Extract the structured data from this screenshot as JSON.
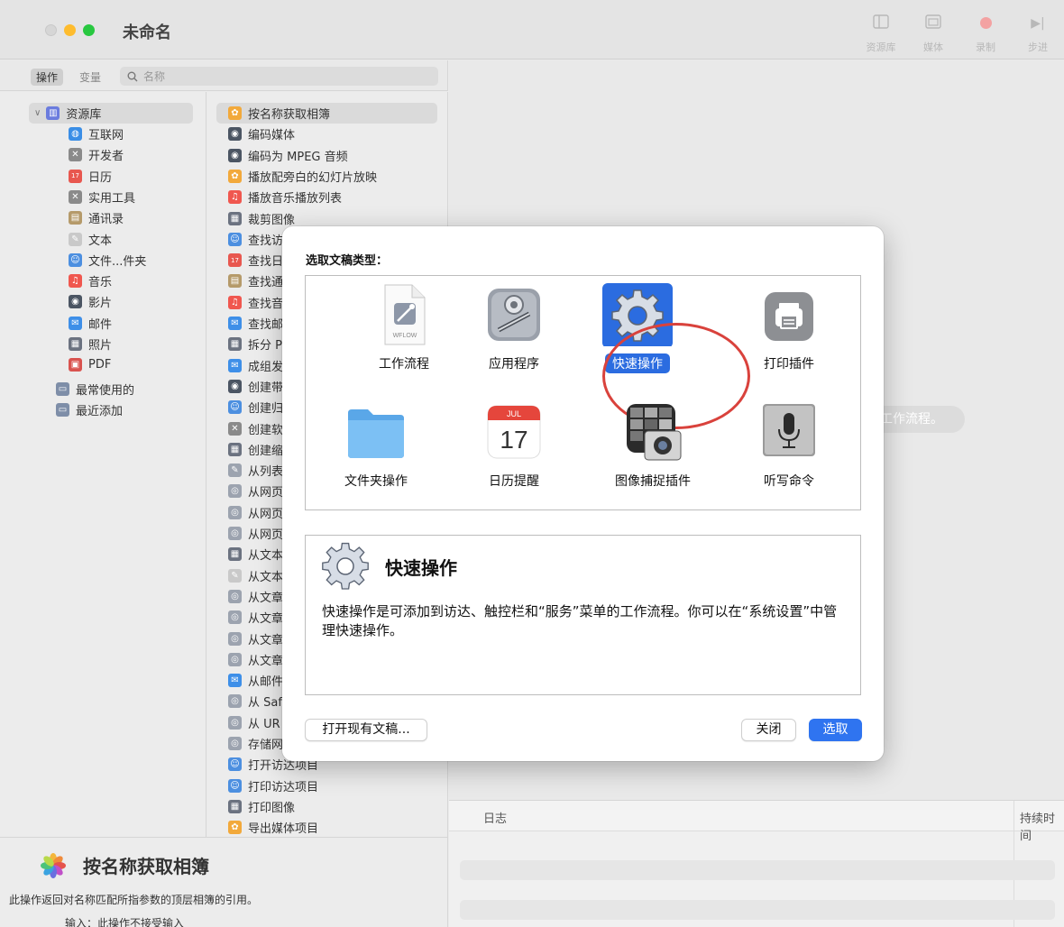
{
  "window": {
    "title": "未命名"
  },
  "toolbar": [
    {
      "label": "资源库",
      "icon": "library-icon"
    },
    {
      "label": "媒体",
      "icon": "media-icon"
    },
    {
      "label": "录制",
      "icon": "record-icon"
    },
    {
      "label": "步进",
      "icon": "step-icon"
    }
  ],
  "leftbar": {
    "tab_actions": "操作",
    "tab_variables": "变量",
    "search_placeholder": "名称"
  },
  "library": {
    "root_label": "资源库",
    "items": [
      {
        "label": "互联网",
        "icon": "globe-icon",
        "color": "#3a8ee6"
      },
      {
        "label": "开发者",
        "icon": "tools-icon",
        "color": "#8a8a8a"
      },
      {
        "label": "日历",
        "icon": "calendar-icon",
        "color": "#e8574f"
      },
      {
        "label": "实用工具",
        "icon": "tools-icon",
        "color": "#8a8a8a"
      },
      {
        "label": "通讯录",
        "icon": "contacts-icon",
        "color": "#b59a6a"
      },
      {
        "label": "文本",
        "icon": "text-icon",
        "color": "#c9c9c9"
      },
      {
        "label": "文件...件夹",
        "icon": "finder-icon",
        "color": "#4c8fe0"
      },
      {
        "label": "音乐",
        "icon": "music-icon",
        "color": "#f0574f"
      },
      {
        "label": "影片",
        "icon": "movie-icon",
        "color": "#4b5563"
      },
      {
        "label": "邮件",
        "icon": "mail-icon",
        "color": "#3e8fe8"
      },
      {
        "label": "照片",
        "icon": "photo-icon",
        "color": "#6b7280"
      },
      {
        "label": "PDF",
        "icon": "pdf-icon",
        "color": "#d9534f"
      }
    ],
    "smart": [
      {
        "label": "最常使用的",
        "icon": "smart-folder-icon"
      },
      {
        "label": "最近添加",
        "icon": "smart-folder-icon"
      }
    ]
  },
  "actions": [
    {
      "label": "按名称获取相簿",
      "icon": "photos-icon",
      "color": "#f2a93b"
    },
    {
      "label": "编码媒体",
      "icon": "movie-icon",
      "color": "#4b5563"
    },
    {
      "label": "编码为 MPEG 音频",
      "icon": "movie-icon",
      "color": "#4b5563"
    },
    {
      "label": "播放配旁白的幻灯片放映",
      "icon": "photos-icon",
      "color": "#f2a93b"
    },
    {
      "label": "播放音乐播放列表",
      "icon": "music-icon",
      "color": "#f0574f"
    },
    {
      "label": "裁剪图像",
      "icon": "photo-icon",
      "color": "#6b7280"
    },
    {
      "label": "查找访",
      "icon": "finder-icon",
      "color": "#4c8fe0"
    },
    {
      "label": "查找日",
      "icon": "calendar-icon",
      "color": "#e8574f"
    },
    {
      "label": "查找通",
      "icon": "contacts-icon",
      "color": "#b59a6a"
    },
    {
      "label": "查找音",
      "icon": "music-icon",
      "color": "#f0574f"
    },
    {
      "label": "查找邮",
      "icon": "mail-icon",
      "color": "#3e8fe8"
    },
    {
      "label": "拆分 P",
      "icon": "photo-icon",
      "color": "#6b7280"
    },
    {
      "label": "成组发",
      "icon": "mail-icon",
      "color": "#3e8fe8"
    },
    {
      "label": "创建带",
      "icon": "movie-icon",
      "color": "#4b5563"
    },
    {
      "label": "创建归",
      "icon": "finder-icon",
      "color": "#4c8fe0"
    },
    {
      "label": "创建软",
      "icon": "tools-icon",
      "color": "#8a8a8a"
    },
    {
      "label": "创建缩",
      "icon": "photo-icon",
      "color": "#6b7280"
    },
    {
      "label": "从列表",
      "icon": "script-icon",
      "color": "#9ca3af"
    },
    {
      "label": "从网页",
      "icon": "safari-icon",
      "color": "#9ca3af"
    },
    {
      "label": "从网页",
      "icon": "safari-icon",
      "color": "#9ca3af"
    },
    {
      "label": "从网页",
      "icon": "safari-icon",
      "color": "#9ca3af"
    },
    {
      "label": "从文本",
      "icon": "photo-icon",
      "color": "#6b7280"
    },
    {
      "label": "从文本",
      "icon": "text-icon",
      "color": "#c9c9c9"
    },
    {
      "label": "从文章",
      "icon": "safari-icon",
      "color": "#9ca3af"
    },
    {
      "label": "从文章",
      "icon": "safari-icon",
      "color": "#9ca3af"
    },
    {
      "label": "从文章",
      "icon": "safari-icon",
      "color": "#9ca3af"
    },
    {
      "label": "从文章",
      "icon": "safari-icon",
      "color": "#9ca3af"
    },
    {
      "label": "从邮件",
      "icon": "mail-icon",
      "color": "#3e8fe8"
    },
    {
      "label": "从 Saf",
      "icon": "safari-icon",
      "color": "#9ca3af"
    },
    {
      "label": "从 UR",
      "icon": "safari-icon",
      "color": "#9ca3af"
    },
    {
      "label": "存储网",
      "icon": "safari-icon",
      "color": "#9ca3af"
    },
    {
      "label": "打开访达项目",
      "icon": "finder-icon",
      "color": "#4c8fe0"
    },
    {
      "label": "打印访达项目",
      "icon": "finder-icon",
      "color": "#4c8fe0"
    },
    {
      "label": "打印图像",
      "icon": "photo-icon",
      "color": "#6b7280"
    },
    {
      "label": "导出媒体项目",
      "icon": "photos-icon",
      "color": "#f2a93b"
    }
  ],
  "workarea": {
    "hint": "工作流程。"
  },
  "log": {
    "col_log": "日志",
    "col_duration": "持续时间"
  },
  "description": {
    "title": "按名称获取相簿",
    "text": "此操作返回对名称匹配所指参数的顶层相簿的引用。",
    "input": "输入：此操作不接受输入"
  },
  "dialog": {
    "title": "选取文稿类型：",
    "types": [
      {
        "label": "工作流程",
        "icon": "workflow-document-icon",
        "sublabel": "WFLOW"
      },
      {
        "label": "应用程序",
        "icon": "automator-robot-icon"
      },
      {
        "label": "快速操作",
        "icon": "gear-icon",
        "selected": true
      },
      {
        "label": "打印插件",
        "icon": "printer-icon"
      },
      {
        "label": "文件夹操作",
        "icon": "folder-icon"
      },
      {
        "label": "日历提醒",
        "icon": "calendar-icon",
        "month": "JUL",
        "day": "17"
      },
      {
        "label": "图像捕捉插件",
        "icon": "image-capture-icon"
      },
      {
        "label": "听写命令",
        "icon": "microphone-icon"
      }
    ],
    "info_title": "快速操作",
    "info_text": "快速操作是可添加到访达、触控栏和“服务”菜单的工作流程。你可以在“系统设置”中管理快速操作。",
    "open_existing": "打开现有文稿...",
    "close": "关闭",
    "choose": "选取",
    "accent": "#2f74f0"
  }
}
